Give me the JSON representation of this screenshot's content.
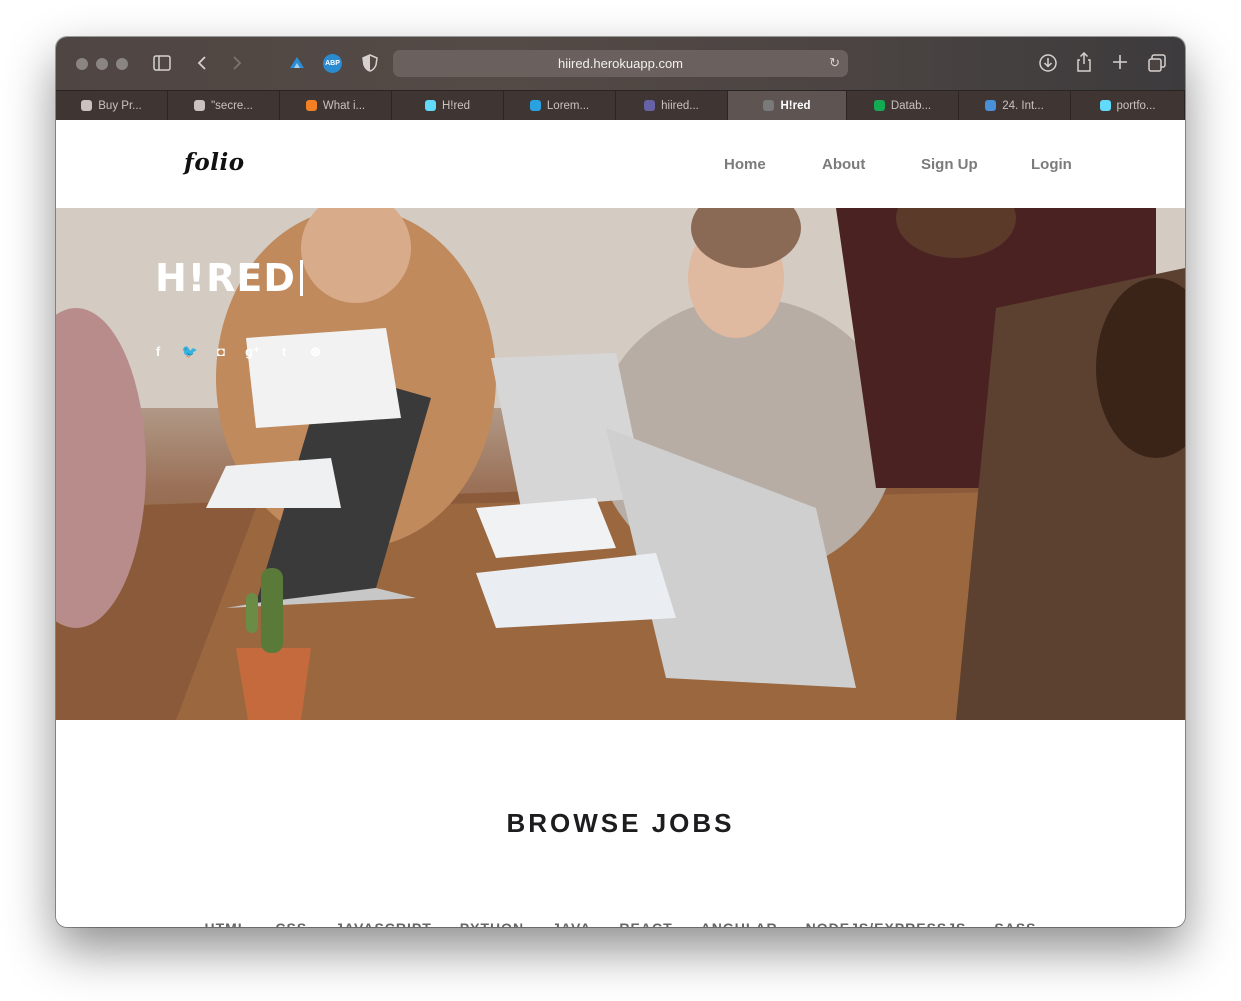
{
  "browser": {
    "url": "hiired.herokuapp.com",
    "tabs": [
      {
        "label": "Buy Pr...",
        "icon": "apple-icon",
        "color": "#c9c2bf"
      },
      {
        "label": "\"secre...",
        "icon": "speech-bubble-icon",
        "color": "#c9c2bf"
      },
      {
        "label": "What i...",
        "icon": "stackoverflow-icon",
        "color": "#f48024"
      },
      {
        "label": "H!red",
        "icon": "react-icon",
        "color": "#61dafb"
      },
      {
        "label": "Lorem...",
        "icon": "number-icon",
        "color": "#2aa1e0"
      },
      {
        "label": "hiired...",
        "icon": "heroku-icon",
        "color": "#6762a6"
      },
      {
        "label": "H!red",
        "icon": "h-icon",
        "color": "#7a7a7a",
        "active": true
      },
      {
        "label": "Datab...",
        "icon": "mongodb-leaf-icon",
        "color": "#13aa52"
      },
      {
        "label": "24. Int...",
        "icon": "cloud-icon",
        "color": "#4a8fd9"
      },
      {
        "label": "portfo...",
        "icon": "react-icon",
        "color": "#61dafb"
      }
    ]
  },
  "nav": {
    "logo": "folio",
    "links": [
      "Home",
      "About",
      "Sign Up",
      "Login"
    ]
  },
  "hero": {
    "title": "H!RED",
    "social": [
      {
        "icon": "facebook-icon",
        "glyph": "f"
      },
      {
        "icon": "twitter-icon",
        "glyph": "🐦"
      },
      {
        "icon": "instagram-icon",
        "glyph": "◘"
      },
      {
        "icon": "google-plus-icon",
        "glyph": "g⁺"
      },
      {
        "icon": "tumblr-icon",
        "glyph": "t"
      },
      {
        "icon": "dribbble-icon",
        "glyph": "⊛"
      }
    ]
  },
  "browse": {
    "heading": "BROWSE JOBS",
    "categories": [
      "HTML",
      "CSS",
      "JAVASCRIPT",
      "PYTHON",
      "JAVA",
      "REACT",
      "ANGULAR",
      "NODEJS/EXPRESSJS",
      "SASS"
    ]
  }
}
